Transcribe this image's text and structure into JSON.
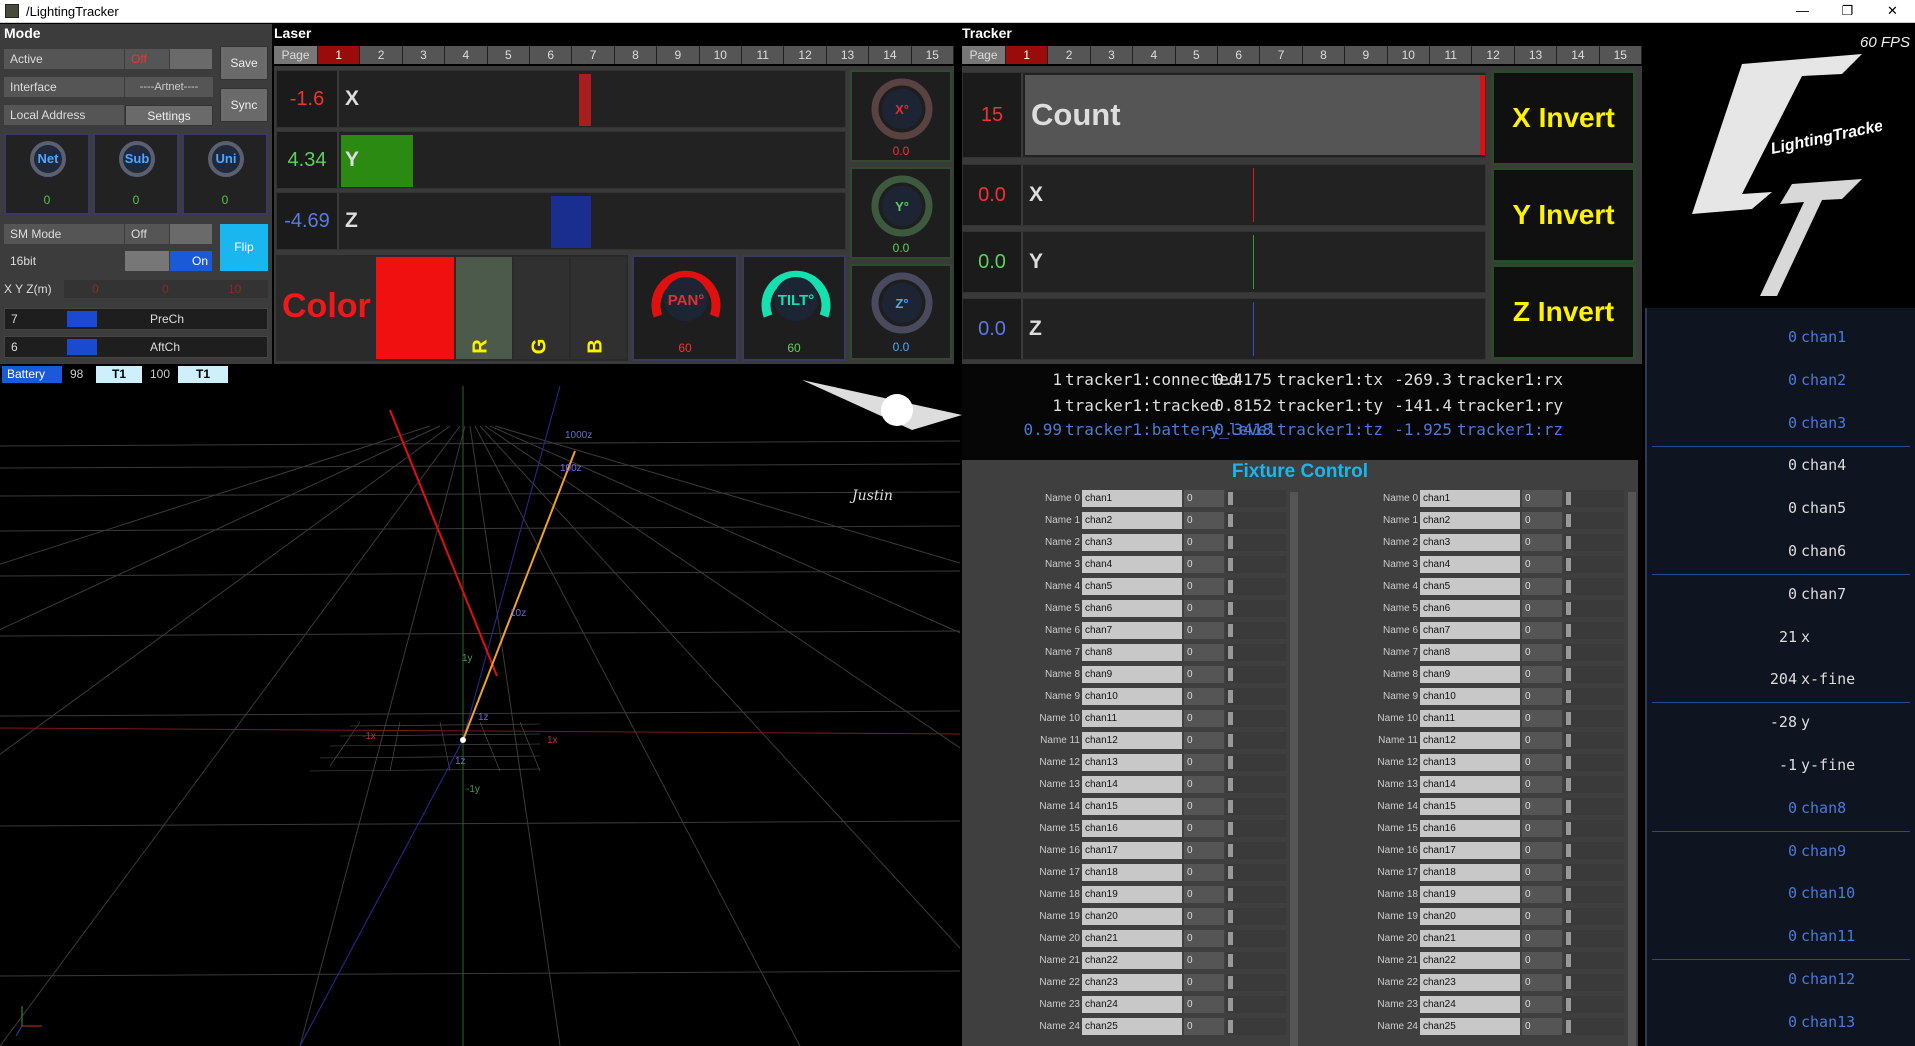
{
  "window": {
    "title": "/LightingTracker",
    "controls": [
      "—",
      "❐",
      "✕"
    ]
  },
  "mode": {
    "title": "Mode",
    "active_label": "Active",
    "active_value": "Off",
    "interface_label": "Interface",
    "interface_value": "----Artnet----",
    "local_label": "Local Address",
    "settings_label": "Settings",
    "save_label": "Save",
    "sync_label": "Sync",
    "knobs": [
      {
        "label": "Net",
        "value": "0"
      },
      {
        "label": "Sub",
        "value": "0"
      },
      {
        "label": "Uni",
        "value": "0"
      }
    ],
    "sm_label": "SM Mode",
    "sm_value": "Off",
    "bit_label": "16bit",
    "bit_value": "On",
    "flip_label": "Flip",
    "xyz_label": "X Y Z(m)",
    "xyz_values": [
      "0",
      "0",
      "10"
    ],
    "prech_num": "7",
    "prech_label": "PreCh",
    "aftch_num": "6",
    "aftch_label": "AftCh",
    "battery_label": "Battery",
    "battery_v1": "98",
    "battery_t1": "T1",
    "battery_v2": "100",
    "battery_t2": "T1"
  },
  "laser": {
    "title": "Laser",
    "page_label": "Page",
    "pages": [
      "1",
      "2",
      "3",
      "4",
      "5",
      "6",
      "7",
      "8",
      "9",
      "10",
      "11",
      "12",
      "13",
      "14",
      "15"
    ],
    "x": {
      "value": "-1.6",
      "name": "X"
    },
    "y": {
      "value": "4.34",
      "name": "Y"
    },
    "z": {
      "value": "-4.69",
      "name": "Z"
    },
    "rot": [
      {
        "label": "X°",
        "value": "0.0"
      },
      {
        "label": "Y°",
        "value": "0.0"
      },
      {
        "label": "Z°",
        "value": "0.0"
      }
    ],
    "color_label": "Color",
    "rgb": [
      "R",
      "G",
      "B"
    ],
    "pan": {
      "label": "PAN°",
      "value": "60"
    },
    "tilt": {
      "label": "TILT°",
      "value": "60"
    }
  },
  "tracker": {
    "title": "Tracker",
    "page_label": "Page",
    "pages": [
      "1",
      "2",
      "3",
      "4",
      "5",
      "6",
      "7",
      "8",
      "9",
      "10",
      "11",
      "12",
      "13",
      "14",
      "15"
    ],
    "count": {
      "value": "15",
      "name": "Count"
    },
    "x": {
      "value": "0.0",
      "name": "X"
    },
    "y": {
      "value": "0.0",
      "name": "Y"
    },
    "z": {
      "value": "0.0",
      "name": "Z"
    },
    "inverts": [
      "X Invert",
      "Y Invert",
      "Z Invert"
    ],
    "readout": [
      [
        "1",
        "tracker1:connected",
        "0.4175",
        "tracker1:tx",
        "-269.3",
        "tracker1:rx"
      ],
      [
        "1",
        "tracker1:tracked",
        "0.8152",
        "tracker1:ty",
        "-141.4",
        "tracker1:ry"
      ],
      [
        "0.99",
        "tracker1:battery_level",
        "-0.3418",
        "tracker1:tz",
        "-1.925",
        "tracker1:rz"
      ]
    ]
  },
  "fixture": {
    "title": "Fixture Control",
    "rows": [
      {
        "name": "Name 0",
        "chan": "chan1",
        "val": "0"
      },
      {
        "name": "Name 1",
        "chan": "chan2",
        "val": "0"
      },
      {
        "name": "Name 2",
        "chan": "chan3",
        "val": "0"
      },
      {
        "name": "Name 3",
        "chan": "chan4",
        "val": "0"
      },
      {
        "name": "Name 4",
        "chan": "chan5",
        "val": "0"
      },
      {
        "name": "Name 5",
        "chan": "chan6",
        "val": "0"
      },
      {
        "name": "Name 6",
        "chan": "chan7",
        "val": "0"
      },
      {
        "name": "Name 7",
        "chan": "chan8",
        "val": "0"
      },
      {
        "name": "Name 8",
        "chan": "chan9",
        "val": "0"
      },
      {
        "name": "Name 9",
        "chan": "chan10",
        "val": "0"
      },
      {
        "name": "Name 10",
        "chan": "chan11",
        "val": "0"
      },
      {
        "name": "Name 11",
        "chan": "chan12",
        "val": "0"
      },
      {
        "name": "Name 12",
        "chan": "chan13",
        "val": "0"
      },
      {
        "name": "Name 13",
        "chan": "chan14",
        "val": "0"
      },
      {
        "name": "Name 14",
        "chan": "chan15",
        "val": "0"
      },
      {
        "name": "Name 15",
        "chan": "chan16",
        "val": "0"
      },
      {
        "name": "Name 16",
        "chan": "chan17",
        "val": "0"
      },
      {
        "name": "Name 17",
        "chan": "chan18",
        "val": "0"
      },
      {
        "name": "Name 18",
        "chan": "chan19",
        "val": "0"
      },
      {
        "name": "Name 19",
        "chan": "chan20",
        "val": "0"
      },
      {
        "name": "Name 20",
        "chan": "chan21",
        "val": "0"
      },
      {
        "name": "Name 21",
        "chan": "chan22",
        "val": "0"
      },
      {
        "name": "Name 22",
        "chan": "chan23",
        "val": "0"
      },
      {
        "name": "Name 23",
        "chan": "chan24",
        "val": "0"
      },
      {
        "name": "Name 24",
        "chan": "chan25",
        "val": "0"
      }
    ]
  },
  "logo": {
    "fps": "60 FPS",
    "text": "LightingTracker"
  },
  "channels": [
    {
      "v": "0",
      "n": "chan1",
      "c": "#4a7ad8"
    },
    {
      "v": "0",
      "n": "chan2",
      "c": "#4a7ad8"
    },
    {
      "v": "0",
      "n": "chan3",
      "c": "#4a7ad8"
    },
    {
      "v": "0",
      "n": "chan4",
      "c": "#ddd"
    },
    {
      "v": "0",
      "n": "chan5",
      "c": "#ddd"
    },
    {
      "v": "0",
      "n": "chan6",
      "c": "#ddd"
    },
    {
      "v": "0",
      "n": "chan7",
      "c": "#ddd"
    },
    {
      "v": "21",
      "n": "x",
      "c": "#ddd"
    },
    {
      "v": "204",
      "n": "x-fine",
      "c": "#ddd"
    },
    {
      "v": "-28",
      "n": "y",
      "c": "#ddd"
    },
    {
      "v": "-1",
      "n": "y-fine",
      "c": "#ddd"
    },
    {
      "v": "0",
      "n": "chan8",
      "c": "#4a7ad8"
    },
    {
      "v": "0",
      "n": "chan9",
      "c": "#4a7ad8"
    },
    {
      "v": "0",
      "n": "chan10",
      "c": "#4a7ad8"
    },
    {
      "v": "0",
      "n": "chan11",
      "c": "#4a7ad8"
    },
    {
      "v": "0",
      "n": "chan12",
      "c": "#4a7ad8"
    },
    {
      "v": "0",
      "n": "chan13",
      "c": "#4a7ad8"
    }
  ],
  "viewport": {
    "labels": [
      "1000z",
      "100z",
      "10z",
      "1y",
      "1z",
      "-1x",
      "1x",
      "-1y",
      "1z"
    ]
  }
}
